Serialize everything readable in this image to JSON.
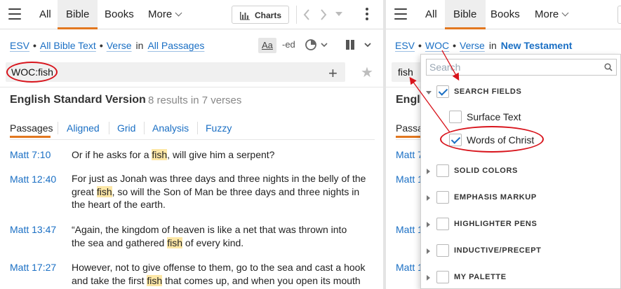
{
  "left": {
    "tabs": [
      "All",
      "Bible",
      "Books",
      "More"
    ],
    "charts_label": "Charts",
    "breadcrumb": {
      "version": "ESV",
      "scope": "All Bible Text",
      "unit": "Verse",
      "in_word": "in",
      "range": "All Passages"
    },
    "tool_aa": "Aa",
    "tool_ed": "-ed",
    "search_query": "WOC:fish",
    "version_name": "English Standard Version",
    "result_count": "8 results in 7 verses",
    "subtabs": [
      "Passages",
      "Aligned",
      "Grid",
      "Analysis",
      "Fuzzy"
    ],
    "results": [
      {
        "ref": "Matt 7:10",
        "lines": [
          {
            "pre": "Or if he asks for a ",
            "hl": "fish",
            "post": ", will give him a serpent?"
          }
        ]
      },
      {
        "ref": "Matt 12:40",
        "lines": [
          {
            "pre": "For just as Jonah was three days and three nights in the belly of the",
            "hl": "",
            "post": ""
          },
          {
            "pre": "great ",
            "hl": "fish",
            "post": ", so will the Son of Man be three days and three nights in"
          },
          {
            "pre": "the heart of the earth.",
            "hl": "",
            "post": ""
          }
        ]
      },
      {
        "ref": "Matt 13:47",
        "lines": [
          {
            "pre": "“Again, the kingdom of heaven is like a net that was thrown into",
            "hl": "",
            "post": ""
          },
          {
            "pre": "the sea and gathered ",
            "hl": "fish",
            "post": " of every kind."
          }
        ]
      },
      {
        "ref": "Matt 17:27",
        "lines": [
          {
            "pre": "However, not to give offense to them, go to the sea and cast a hook",
            "hl": "",
            "post": ""
          },
          {
            "pre": "and take the first ",
            "hl": "fish",
            "post": " that comes up, and when you open its mouth"
          }
        ]
      }
    ]
  },
  "right": {
    "tabs": [
      "All",
      "Bible",
      "Books",
      "More"
    ],
    "breadcrumb": {
      "version": "ESV",
      "scope": "WOC",
      "unit": "Verse",
      "in_word": "in",
      "range": "New Testament"
    },
    "search_query": "fish",
    "version_name_partial": "Engl",
    "subtab_partial": "Passa",
    "refs_partial": [
      "Matt 7",
      "Matt 1",
      "Matt 1",
      "Matt 1"
    ]
  },
  "dropdown": {
    "search_placeholder": "Search",
    "section_search_fields": "SEARCH FIELDS",
    "surface_text": "Surface Text",
    "words_of_christ": "Words of Christ",
    "groups": [
      "SOLID COLORS",
      "EMPHASIS MARKUP",
      "HIGHLIGHTER PENS",
      "INDUCTIVE/PRECEPT",
      "MY PALETTE"
    ],
    "surface_text_checked": false,
    "words_of_christ_checked": true,
    "search_fields_checked": true
  },
  "colors": {
    "link": "#1a6fc4",
    "accent_orange": "#e2771f",
    "highlight": "#fde7a6",
    "annotation_red": "#d8141c"
  }
}
